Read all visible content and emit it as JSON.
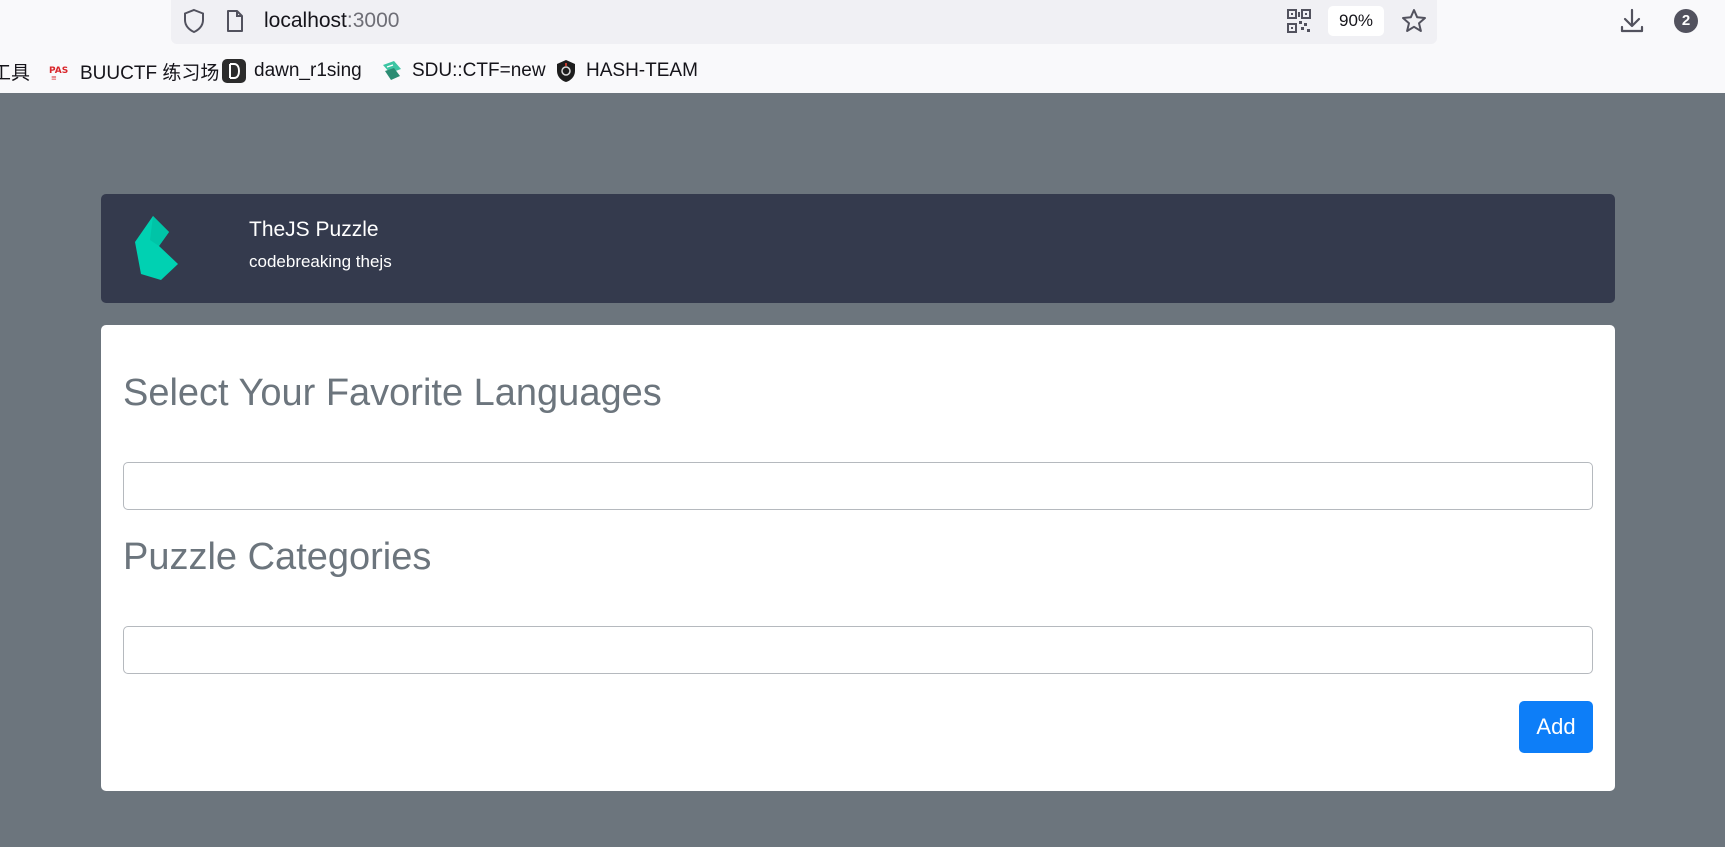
{
  "browser": {
    "url_host": "localhost",
    "url_port": ":3000",
    "zoom_level": "90%",
    "notification_count": "2",
    "icons": {
      "shield": "shield-icon",
      "page": "page-icon",
      "qr": "qr-code-icon",
      "bookmark_star": "star-icon",
      "download": "download-icon"
    },
    "bookmarks": [
      {
        "label": "工具",
        "icon": "none"
      },
      {
        "label": "BUUCTF 练习场",
        "icon": "buuctf-favicon-icon"
      },
      {
        "label": "dawn_r1sing",
        "icon": "dawn-favicon-icon"
      },
      {
        "label": "SDU::CTF=new",
        "icon": "sdu-favicon-icon"
      },
      {
        "label": "HASH-TEAM",
        "icon": "hash-team-favicon-icon"
      }
    ]
  },
  "header": {
    "title": "TheJS Puzzle",
    "subtitle": "codebreaking thejs",
    "logo_icon": "logo-icon"
  },
  "form": {
    "languages_heading": "Select Your Favorite Languages",
    "languages_value": "",
    "categories_heading": "Puzzle Categories",
    "categories_value": "",
    "add_label": "Add"
  },
  "colors": {
    "page_background": "#6c757d",
    "header_background": "#343a4d",
    "logo_accent": "#00d1b2",
    "primary_button": "#0d7ef8",
    "heading_text": "#6c757d"
  }
}
